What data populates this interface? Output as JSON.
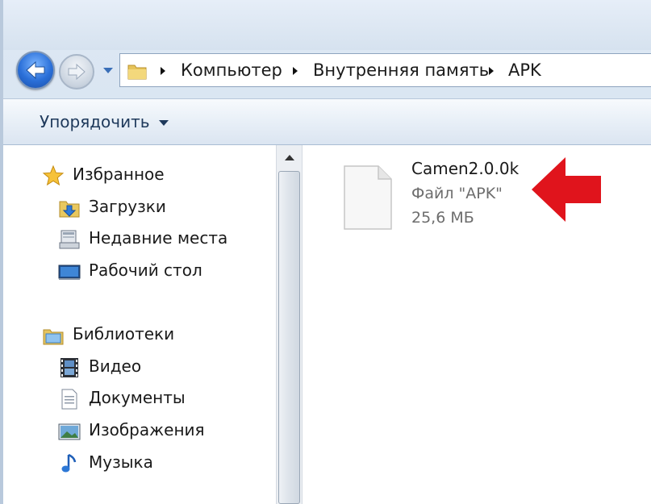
{
  "nav": {
    "back_icon": "back-arrow-icon",
    "forward_icon": "forward-arrow-icon",
    "history_icon": "chevron-down-icon"
  },
  "breadcrumb": [
    "Компьютер",
    "Внутренняя память",
    "APK"
  ],
  "toolbar": {
    "organize_label": "Упорядочить"
  },
  "sidebar": {
    "favorites": {
      "label": "Избранное",
      "icon": "star-icon",
      "items": [
        {
          "label": "Загрузки",
          "icon": "downloads-folder-icon"
        },
        {
          "label": "Недавние места",
          "icon": "recent-places-icon"
        },
        {
          "label": "Рабочий стол",
          "icon": "desktop-icon"
        }
      ]
    },
    "libraries": {
      "label": "Библиотеки",
      "icon": "libraries-icon",
      "items": [
        {
          "label": "Видео",
          "icon": "video-icon"
        },
        {
          "label": "Документы",
          "icon": "documents-icon"
        },
        {
          "label": "Изображения",
          "icon": "images-icon"
        },
        {
          "label": "Музыка",
          "icon": "music-icon"
        }
      ]
    }
  },
  "files": [
    {
      "name": "Camen2.0.0k",
      "type": "Файл \"APK\"",
      "size": "25,6 МБ",
      "icon": "file-icon"
    }
  ],
  "colors": {
    "accent_arrow": "#e0141c",
    "toolbar_text": "#1e395b",
    "secondary_text": "#6d6d6d"
  }
}
